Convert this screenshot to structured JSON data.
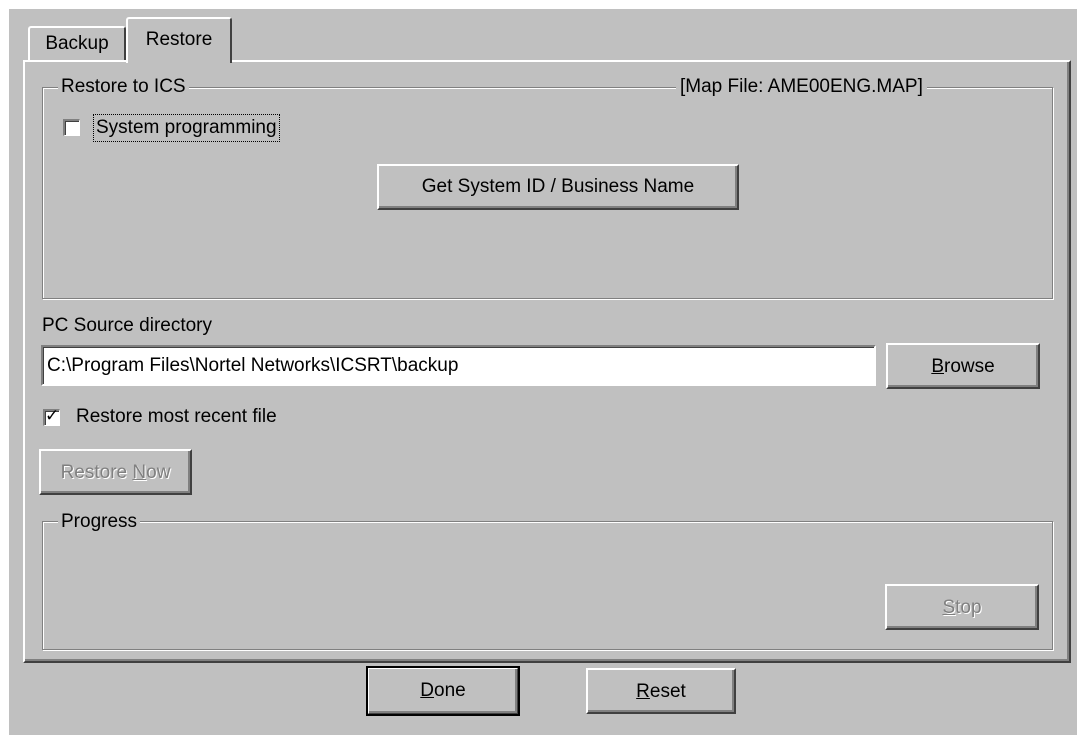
{
  "tabs": {
    "backup": "Backup",
    "restore": "Restore"
  },
  "restore_to_ics": {
    "legend": "Restore to ICS",
    "map_file": "[Map File:  AME00ENG.MAP]",
    "system_programming": {
      "label": "System programming",
      "checked": false
    },
    "get_system_id_button": "Get System ID / Business Name"
  },
  "source": {
    "label": "PC Source directory",
    "value": "C:\\Program Files\\Nortel Networks\\ICSRT\\backup",
    "browse_button_accel": "B",
    "browse_button_rest": "rowse"
  },
  "restore_most_recent": {
    "label": "Restore most recent file",
    "checked": true,
    "checkmark_glyph": "✓"
  },
  "restore_now_button": {
    "prefix": "Restore ",
    "accel": "N",
    "rest": "ow",
    "enabled": false
  },
  "progress": {
    "legend": "Progress",
    "stop_accel": "S",
    "stop_rest": "top",
    "stop_enabled": false
  },
  "footer": {
    "done_accel": "D",
    "done_rest": "one",
    "reset_accel": "R",
    "reset_rest": "eset"
  }
}
